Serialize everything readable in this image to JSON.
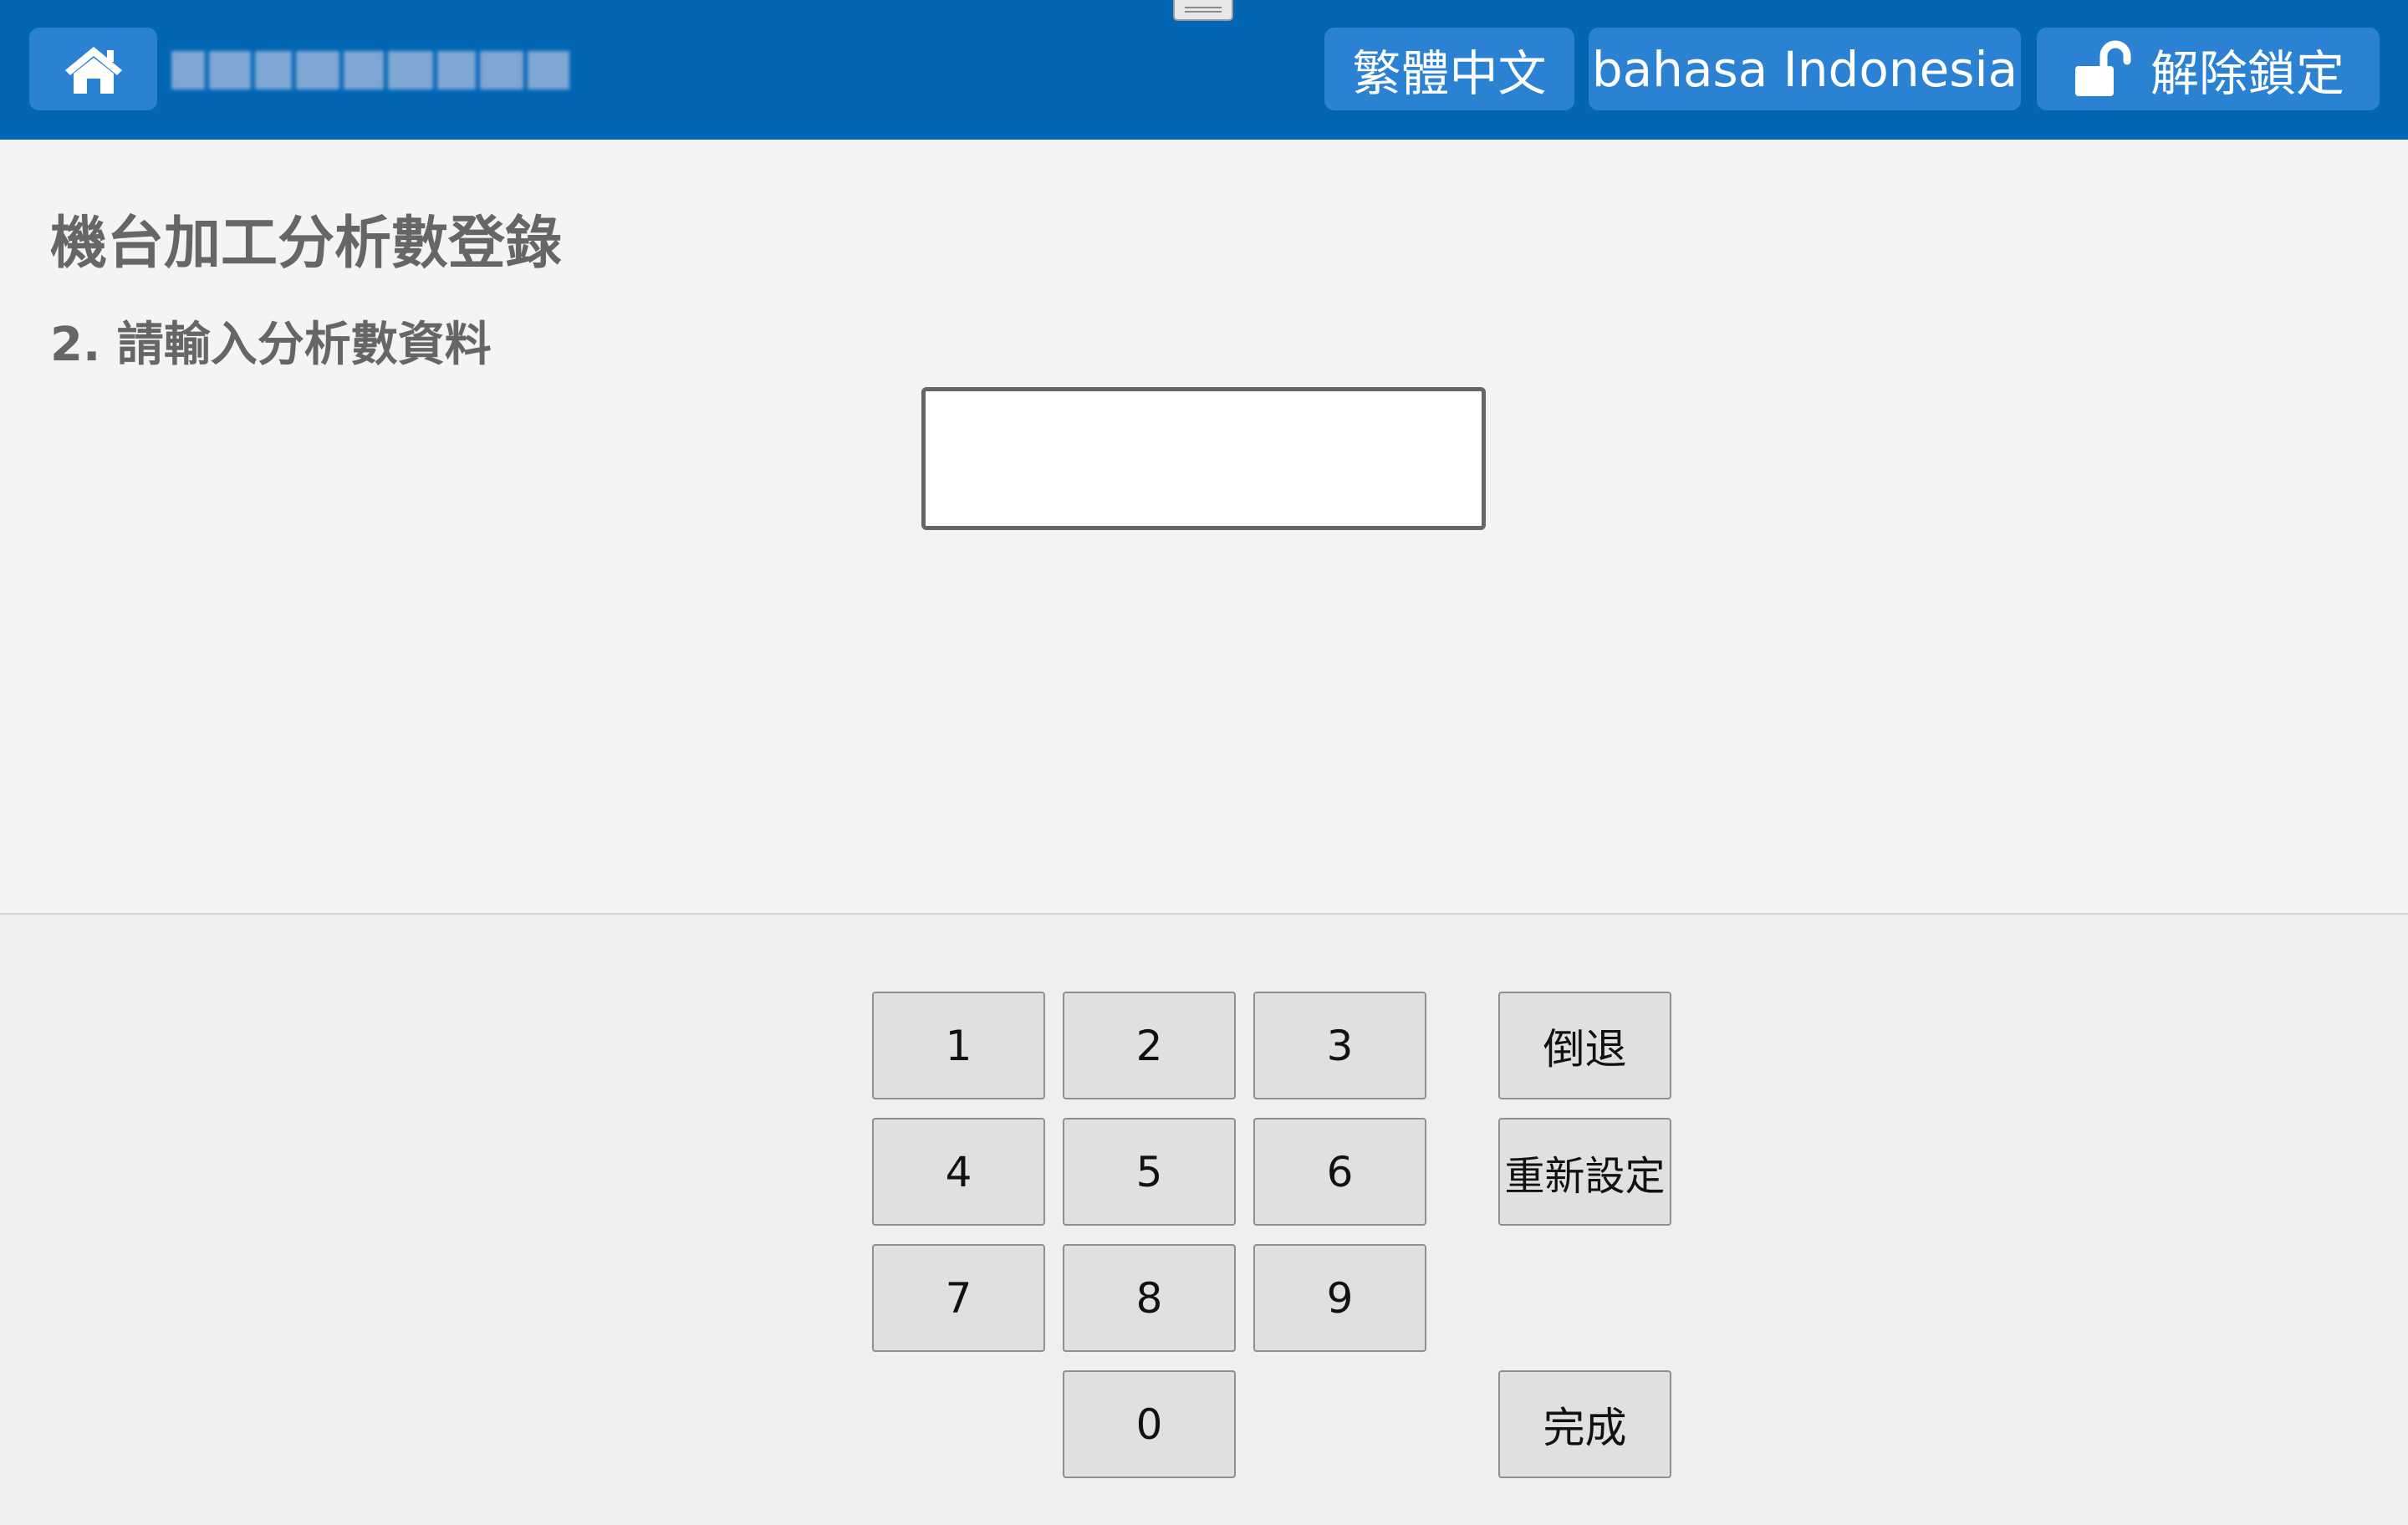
{
  "header": {
    "home_icon": "home-icon",
    "lang_zh_label": "繁體中文",
    "lang_id_label": "bahasa Indonesia",
    "unlock_icon": "unlock-icon",
    "unlock_label": "解除鎖定",
    "brand_color": "#0266b5",
    "button_color": "#2b82d3"
  },
  "page": {
    "title": "機台加工分析數登錄",
    "step_label": "2. 請輸入分析數資料"
  },
  "input": {
    "value": "",
    "placeholder": ""
  },
  "keypad": {
    "digits": [
      "1",
      "2",
      "3",
      "4",
      "5",
      "6",
      "7",
      "8",
      "9",
      "0"
    ],
    "backspace_label": "倒退",
    "reset_label": "重新設定",
    "done_label": "完成"
  }
}
